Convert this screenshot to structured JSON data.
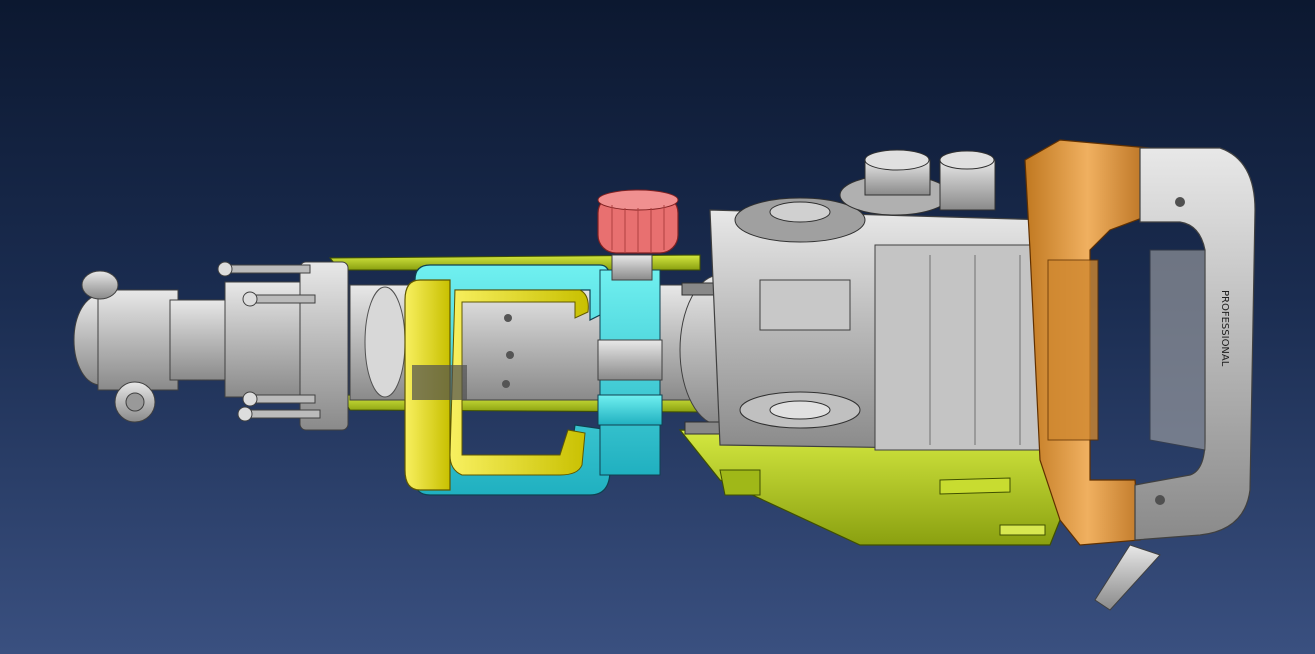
{
  "viewport": {
    "background_top": "#0c1830",
    "background_bottom": "#3a5080"
  },
  "model": {
    "description_icon": "demolition-hammer-cad-assembly",
    "handle_label": "PROFESSIONAL",
    "colors": {
      "body_green": "#b8d020",
      "metal_gray": "#c8c8c8",
      "handle_yellow": "#f0ea10",
      "handle_cyan": "#40d8e0",
      "knob_red": "#e87070",
      "grip_orange": "#e8a040",
      "rear_handle_gray": "#b8b8b8"
    }
  }
}
